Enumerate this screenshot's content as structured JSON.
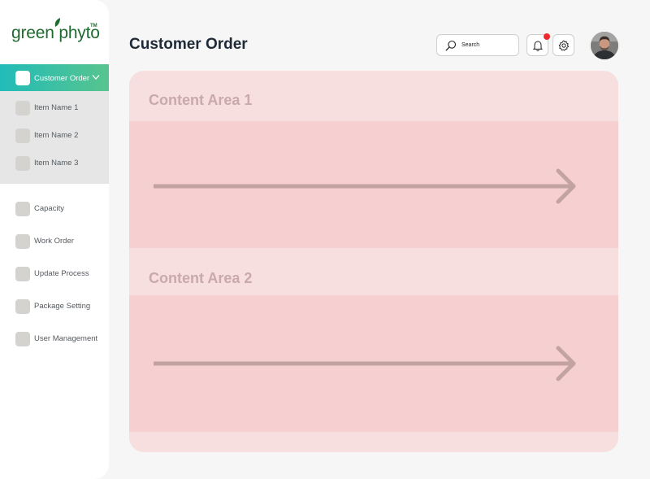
{
  "brand": {
    "name": "green phyto",
    "tm": "TM",
    "color": "#1f6b2f"
  },
  "sidebar": {
    "active": {
      "label": "Customer Order",
      "icon": "chevron-down-icon"
    },
    "sub_items": [
      {
        "label": "Item Name 1"
      },
      {
        "label": "Item Name 2"
      },
      {
        "label": "Item Name 3"
      }
    ],
    "items": [
      {
        "label": "Capacity"
      },
      {
        "label": "Work Order"
      },
      {
        "label": "Update Process"
      },
      {
        "label": "Package Setting"
      },
      {
        "label": "User Management"
      }
    ],
    "accent_gradient": [
      "#21bcb8",
      "#58c48e"
    ]
  },
  "header": {
    "title": "Customer Order",
    "search": {
      "label": "Search",
      "icon": "search-icon"
    },
    "notifications": {
      "icon": "bell-icon",
      "badge_color": "#ee2b2b"
    },
    "settings": {
      "icon": "gear-icon"
    },
    "avatar": "user-avatar"
  },
  "content": {
    "areas": [
      {
        "title": "Content Area 1"
      },
      {
        "title": "Content Area 2"
      }
    ],
    "colors": {
      "panel": "#f7dfe0",
      "body": "#f6cfd0",
      "arrow": "#c3a2a2"
    }
  }
}
